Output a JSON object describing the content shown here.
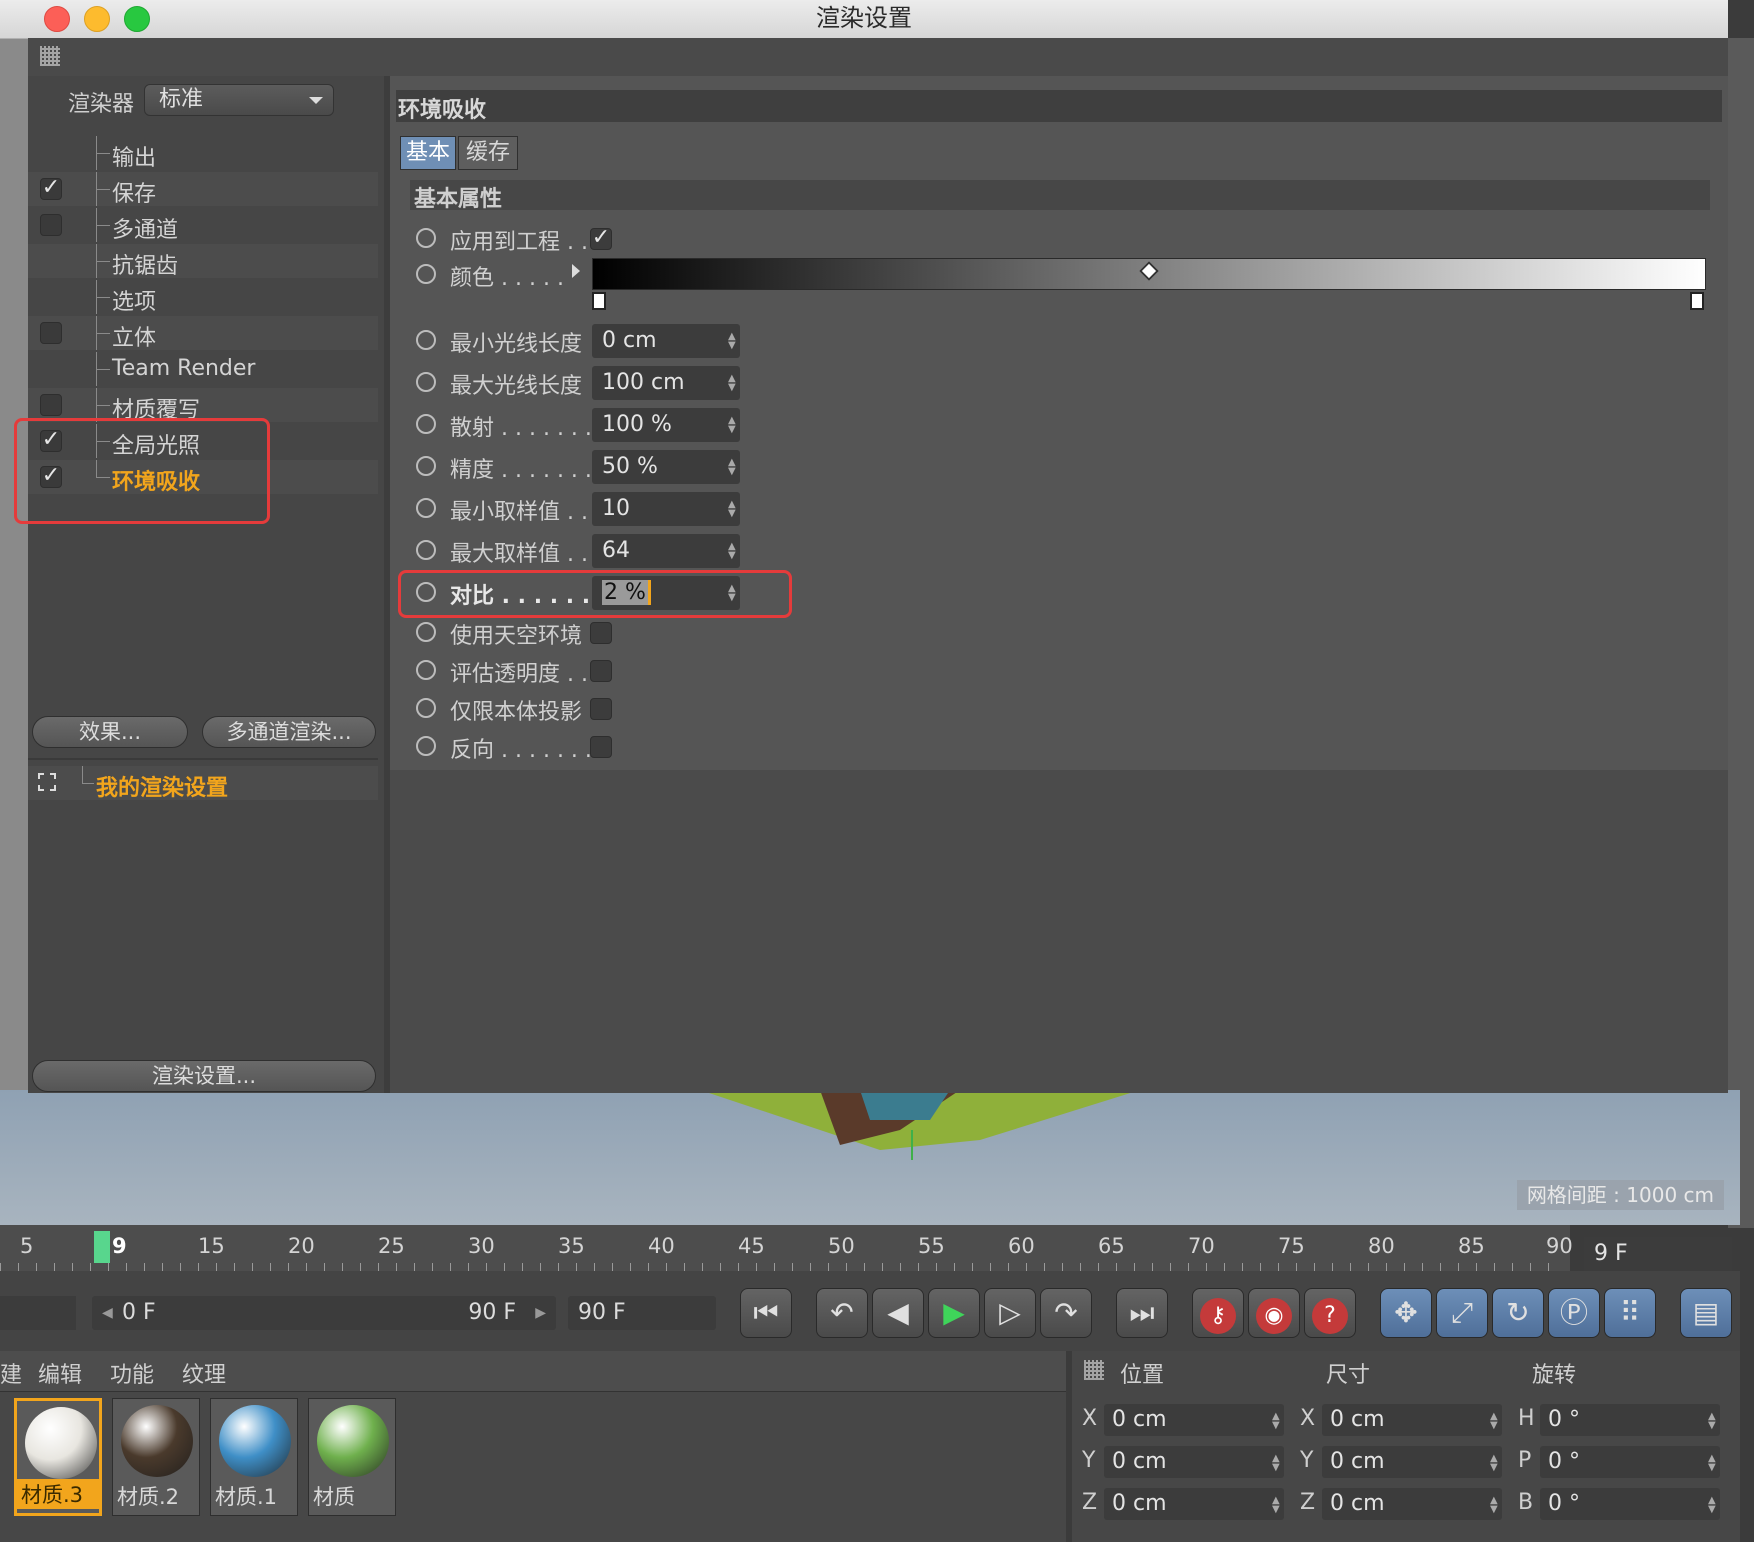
{
  "window": {
    "title": "渲染设置"
  },
  "renderer": {
    "label": "渲染器",
    "value": "标准"
  },
  "tree": [
    {
      "label": "输出",
      "checkbox": false,
      "checked": false,
      "active": false
    },
    {
      "label": "保存",
      "checkbox": true,
      "checked": true,
      "active": false
    },
    {
      "label": "多通道",
      "checkbox": true,
      "checked": false,
      "active": false
    },
    {
      "label": "抗锯齿",
      "checkbox": false,
      "checked": false,
      "active": false
    },
    {
      "label": "选项",
      "checkbox": false,
      "checked": false,
      "active": false
    },
    {
      "label": "立体",
      "checkbox": true,
      "checked": false,
      "active": false
    },
    {
      "label": "Team Render",
      "checkbox": false,
      "checked": false,
      "active": false
    },
    {
      "label": "材质覆写",
      "checkbox": true,
      "checked": false,
      "active": false
    },
    {
      "label": "全局光照",
      "checkbox": true,
      "checked": true,
      "active": false
    },
    {
      "label": "环境吸收",
      "checkbox": true,
      "checked": true,
      "active": true
    }
  ],
  "buttons": {
    "effects": "效果...",
    "multipass": "多通道渲染...",
    "render_settings": "渲染设置..."
  },
  "preset": {
    "label": "我的渲染设置"
  },
  "panel": {
    "title": "环境吸收",
    "tabs": [
      "基本",
      "缓存"
    ],
    "group": "基本属性"
  },
  "params": {
    "apply": {
      "label": "应用到工程 . .",
      "checked": true
    },
    "color": {
      "label": "颜色 . . . . ."
    },
    "min_ray": {
      "label": "最小光线长度",
      "value": "0 cm"
    },
    "max_ray": {
      "label": "最大光线长度",
      "value": "100 cm"
    },
    "dispersion": {
      "label": "散射 . . . . . . .",
      "value": "100 %"
    },
    "accuracy": {
      "label": "精度 . . . . . . .",
      "value": "50 %"
    },
    "min_samples": {
      "label": "最小取样值 . .",
      "value": "10"
    },
    "max_samples": {
      "label": "最大取样值 . .",
      "value": "64"
    },
    "contrast": {
      "label": "对比 . . . . . . .",
      "value": "2 %"
    },
    "sky": {
      "label": "使用天空环境",
      "checked": false
    },
    "transparency": {
      "label": "评估透明度 . .",
      "checked": false
    },
    "self_shadow": {
      "label": "仅限本体投影",
      "checked": false
    },
    "invert": {
      "label": "反向 . . . . . . .",
      "checked": false
    }
  },
  "viewport": {
    "grid_info": "网格间距 : 1000 cm"
  },
  "timeline": {
    "ticks": [
      "5",
      "9",
      "15",
      "20",
      "25",
      "30",
      "35",
      "40",
      "45",
      "50",
      "55",
      "60",
      "65",
      "70",
      "75",
      "80",
      "85",
      "90"
    ],
    "current_frame": "9 F",
    "range_start": "0 F",
    "range_end": "90 F",
    "end_field": "90 F"
  },
  "materials": {
    "menu": [
      "建",
      "编辑",
      "功能",
      "纹理"
    ],
    "items": [
      {
        "label": "材质.3",
        "color": "#e8e6e0",
        "active": true
      },
      {
        "label": "材质.2",
        "color": "#4a3a2c",
        "active": false
      },
      {
        "label": "材质.1",
        "color": "#3f8fc7",
        "active": false
      },
      {
        "label": "材质",
        "color": "#6fb04d",
        "active": false
      }
    ]
  },
  "coords": {
    "headers": [
      "位置",
      "尺寸",
      "旋转"
    ],
    "position": {
      "X": "0 cm",
      "Y": "0 cm",
      "Z": "0 cm"
    },
    "size": {
      "X": "0 cm",
      "Y": "0 cm",
      "Z": "0 cm"
    },
    "rotation": {
      "H": "0 °",
      "P": "0 °",
      "B": "0 °"
    }
  },
  "colors": {
    "accent": "#f2a51c",
    "highlight_box": "#e53b3b"
  }
}
